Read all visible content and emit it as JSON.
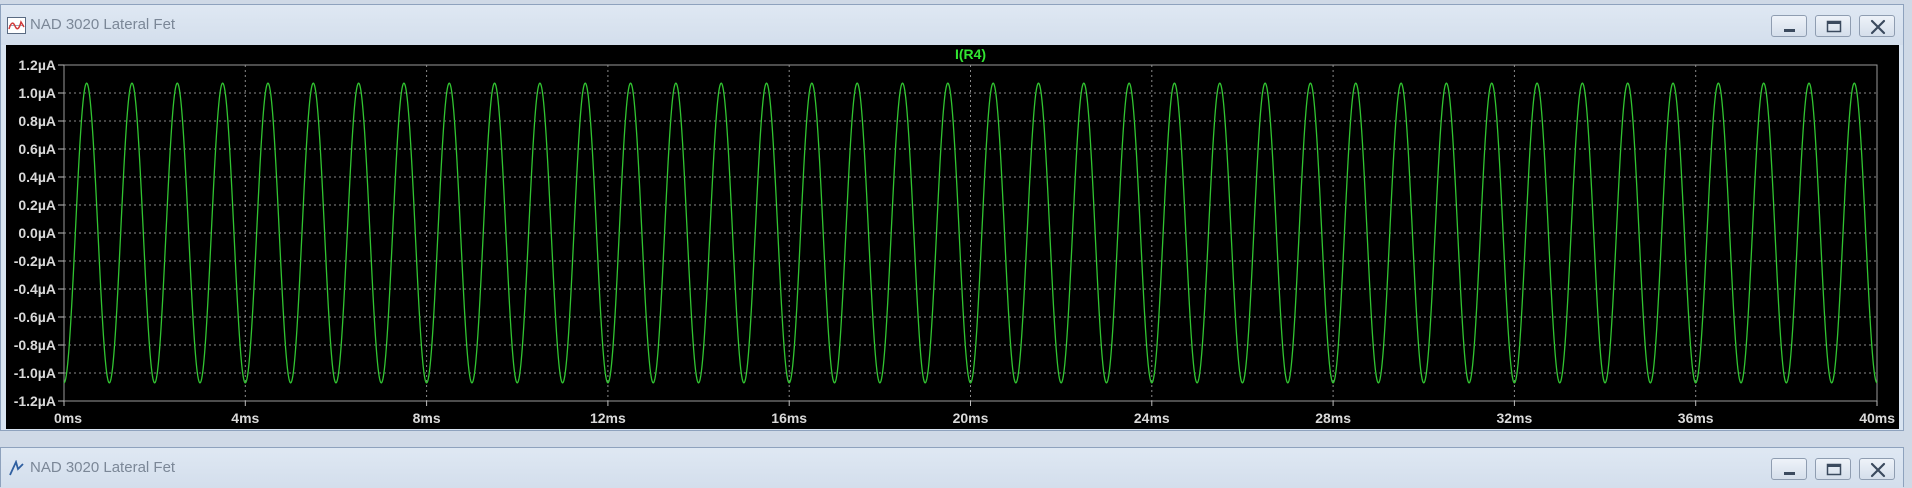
{
  "windows": [
    {
      "title": "NAD 3020 Lateral Fet"
    },
    {
      "title": "NAD 3020 Lateral Fet"
    }
  ],
  "colors": {
    "plot_background": "#000000",
    "trace": "#31c431",
    "title_label": "#31e531",
    "axis_text": "#d9d9d9",
    "grid": "#8a8a8a"
  },
  "icons": {
    "app": "waveform-viewer-icon",
    "minimize": "minimize-icon",
    "maximize": "maximize-icon",
    "close": "close-icon"
  },
  "chart_data": {
    "type": "line",
    "title": "I(R4)",
    "xlabel": "",
    "ylabel": "",
    "x_ticks": [
      "0ms",
      "4ms",
      "8ms",
      "12ms",
      "16ms",
      "20ms",
      "24ms",
      "28ms",
      "32ms",
      "36ms",
      "40ms"
    ],
    "y_ticks": [
      "1.2µA",
      "1.0µA",
      "0.8µA",
      "0.6µA",
      "0.4µA",
      "0.2µA",
      "0.0µA",
      "-0.2µA",
      "-0.4µA",
      "-0.6µA",
      "-0.8µA",
      "-1.0µA",
      "-1.2µA"
    ],
    "xlim": [
      0,
      40
    ],
    "ylim": [
      -1.2,
      1.2
    ],
    "grid": true,
    "series": [
      {
        "name": "I(R4)",
        "waveform": "sine",
        "amplitude": 1.07,
        "period": 1.0,
        "phase_deg": -90,
        "x_start": 0,
        "x_end": 40
      }
    ]
  }
}
